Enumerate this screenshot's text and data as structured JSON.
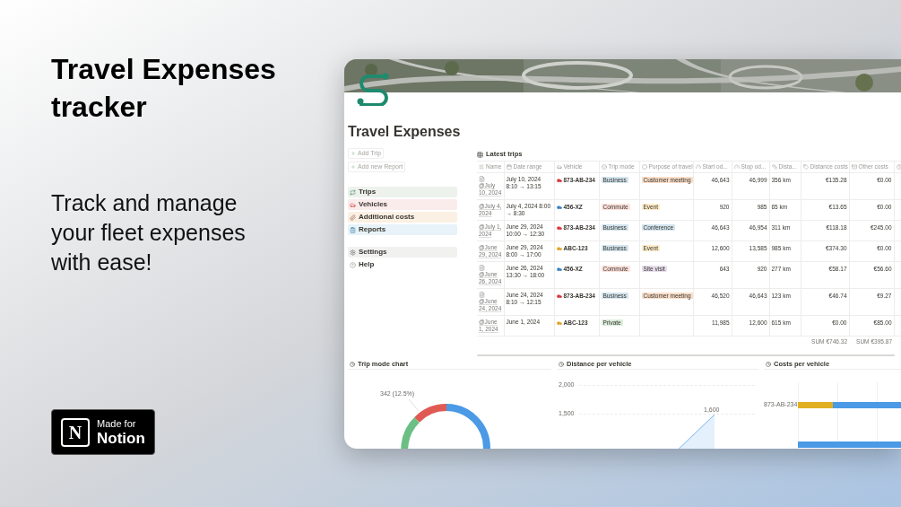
{
  "hero": {
    "title": "Travel Expenses tracker",
    "subtitle": "Track and manage your fleet expenses with ease!"
  },
  "badge": {
    "logo_letter": "N",
    "line1": "Made for",
    "line2": "Notion"
  },
  "page": {
    "title": "Travel Expenses",
    "actions": [
      "Add Trip",
      "Add new Report"
    ],
    "nav": [
      {
        "label": "Trips",
        "color": "#edf3ec"
      },
      {
        "label": "Vehicles",
        "color": "#fbecec"
      },
      {
        "label": "Additional costs",
        "color": "#fbf0e4"
      },
      {
        "label": "Reports",
        "color": "#e7f3f8"
      }
    ],
    "nav2": [
      {
        "label": "Settings",
        "color": "#f1f1ef"
      },
      {
        "label": "Help"
      }
    ]
  },
  "table": {
    "title": "Latest trips",
    "columns": [
      "Name",
      "Date range",
      "Vehicle",
      "Trip mode",
      "Purpose of travel",
      "Start od...",
      "Stop od...",
      "Dista...",
      "Distance costs",
      "Other costs"
    ],
    "rows": [
      {
        "page_icon": true,
        "name": "@July 10, 2024",
        "date": "July 10, 2024 8:10 → 13:15",
        "vehicle": {
          "label": "873-AB-234",
          "color": "#d9383a"
        },
        "mode": {
          "label": "Business",
          "color": "#d3e5ef"
        },
        "purpose": {
          "label": "Customer meeting",
          "color": "#fadec9"
        },
        "start": "46,643",
        "stop": "46,999",
        "distance": "356 km",
        "distance_cost": "€135.28",
        "other_cost": "€0.00"
      },
      {
        "page_icon": false,
        "name": "@July 4, 2024",
        "date": "July 4, 2024 8:00 → 8:30",
        "vehicle": {
          "label": "456-XZ",
          "color": "#3b82c4"
        },
        "mode": {
          "label": "Commute",
          "color": "#ffe2dd"
        },
        "purpose": {
          "label": "Event",
          "color": "#fdecc8"
        },
        "start": "920",
        "stop": "985",
        "distance": "65 km",
        "distance_cost": "€13.65",
        "other_cost": "€0.00"
      },
      {
        "page_icon": false,
        "name": "@July 1, 2024",
        "date": "June 29, 2024 10:00 → 12:30",
        "vehicle": {
          "label": "873-AB-234",
          "color": "#d9383a"
        },
        "mode": {
          "label": "Business",
          "color": "#d3e5ef"
        },
        "purpose": {
          "label": "Conference",
          "color": "#d3e5ef"
        },
        "start": "46,643",
        "stop": "46,954",
        "distance": "311 km",
        "distance_cost": "€118.18",
        "other_cost": "€245.00"
      },
      {
        "page_icon": false,
        "name": "@June 29, 2024",
        "date": "June 29, 2024 8:00 → 17:00",
        "vehicle": {
          "label": "ABC-123",
          "color": "#e0a526"
        },
        "mode": {
          "label": "Business",
          "color": "#d3e5ef"
        },
        "purpose": {
          "label": "Event",
          "color": "#fdecc8"
        },
        "start": "12,600",
        "stop": "13,585",
        "distance": "985 km",
        "distance_cost": "€374.30",
        "other_cost": "€0.00"
      },
      {
        "page_icon": true,
        "name": "@June 26, 2024",
        "date": "June 26, 2024 13:30 → 18:00",
        "vehicle": {
          "label": "456-XZ",
          "color": "#3b82c4"
        },
        "mode": {
          "label": "Commute",
          "color": "#ffe2dd"
        },
        "purpose": {
          "label": "Site visit",
          "color": "#e8deee"
        },
        "start": "643",
        "stop": "920",
        "distance": "277 km",
        "distance_cost": "€58.17",
        "other_cost": "€56.60"
      },
      {
        "page_icon": true,
        "name": "@June 24, 2024",
        "date": "June 24, 2024 8:10 → 12:15",
        "vehicle": {
          "label": "873-AB-234",
          "color": "#d9383a"
        },
        "mode": {
          "label": "Business",
          "color": "#d3e5ef"
        },
        "purpose": {
          "label": "Customer meeting",
          "color": "#fadec9"
        },
        "start": "46,520",
        "stop": "46,643",
        "distance": "123 km",
        "distance_cost": "€46.74",
        "other_cost": "€9.27"
      },
      {
        "page_icon": false,
        "name": "@June 1, 2024",
        "date": "June 1, 2024",
        "vehicle": {
          "label": "ABC-123",
          "color": "#e0a526"
        },
        "mode": {
          "label": "Private",
          "color": "#dbeddb"
        },
        "start": "11,985",
        "stop": "12,600",
        "distance": "615 km",
        "distance_cost": "€0.00",
        "other_cost": "€85.00"
      }
    ],
    "sums": [
      {
        "prefix": "SUM",
        "value": "€746.32"
      },
      {
        "prefix": "SUM",
        "value": "€395.87"
      }
    ]
  },
  "charts": [
    {
      "kind": "donut",
      "title": "Trip mode chart",
      "label": "342 (12.5%)"
    },
    {
      "kind": "line",
      "title": "Distance per vehicle",
      "axis_labels": [
        "2,000",
        "1,500"
      ],
      "point_label": "1,600"
    },
    {
      "kind": "bar",
      "title": "Costs per vehicle",
      "category": "873-AB-234"
    }
  ]
}
